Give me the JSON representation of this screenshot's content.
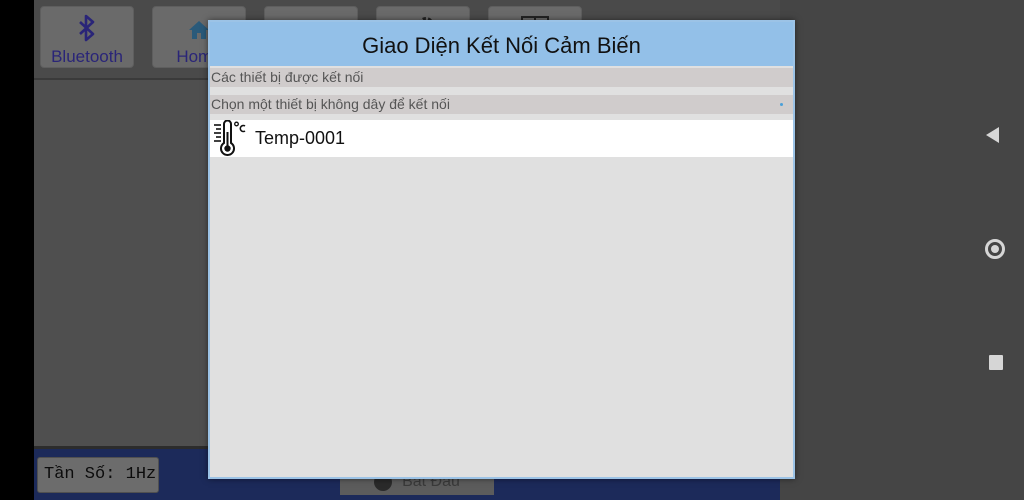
{
  "app": {
    "toolbar": {
      "buttons": [
        {
          "label": "Bluetooth",
          "icon": "bluetooth-icon"
        },
        {
          "label": "Home",
          "icon": "home-icon"
        },
        {
          "label": "",
          "icon": "sensor-icon"
        },
        {
          "label": "",
          "icon": "gear-icon"
        },
        {
          "label": "",
          "icon": "window-icon"
        }
      ]
    },
    "bottom_bar": {
      "frequency_label": "Tần Số: 1Hz",
      "start_button_label": "Bắt Đầu"
    }
  },
  "dialog": {
    "title": "Giao Diện Kết Nối Cảm Biến",
    "paired_header": "Các thiết bị được kết nối",
    "available_header": "Chọn một thiết bị không dây để kết nối",
    "devices": [
      {
        "name": "Temp-0001",
        "icon": "thermometer-celsius-icon"
      }
    ]
  },
  "navbar": {
    "back": "back-icon",
    "home": "home-circle-icon",
    "recents": "recents-icon"
  },
  "colors": {
    "dialog_title_bg": "#93c0e8",
    "section_header_bg": "#d0cccc",
    "toolbar_text": "#2a2578",
    "bottom_bar_bg": "#1c2a5a"
  }
}
